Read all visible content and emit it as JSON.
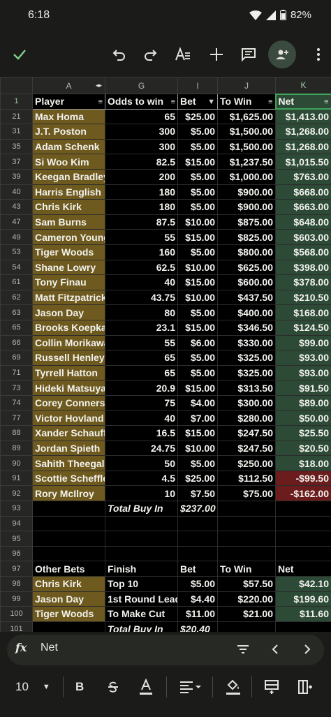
{
  "status": {
    "time": "6:18",
    "battery": "82%"
  },
  "toolbar": {
    "icons": [
      "check-icon",
      "undo-icon",
      "redo-icon",
      "text-format-icon",
      "add-icon",
      "comment-icon",
      "share-icon",
      "more-vert-icon"
    ]
  },
  "columns": [
    "A",
    "G",
    "I",
    "J",
    "K"
  ],
  "header": {
    "row": "1",
    "player": "Player",
    "odds": "Odds to win",
    "bet": "Bet",
    "towin": "To Win",
    "net": "Net"
  },
  "rows": [
    {
      "r": "21",
      "player": "Max Homa",
      "odds": "65",
      "bet": "$25.00",
      "towin": "$1,625.00",
      "net": "$1,413.00"
    },
    {
      "r": "31",
      "player": "J.T. Poston",
      "odds": "300",
      "bet": "$5.00",
      "towin": "$1,500.00",
      "net": "$1,268.00"
    },
    {
      "r": "35",
      "player": "Adam Schenk",
      "odds": "300",
      "bet": "$5.00",
      "towin": "$1,500.00",
      "net": "$1,268.00"
    },
    {
      "r": "37",
      "player": "Si Woo Kim",
      "odds": "82.5",
      "bet": "$15.00",
      "towin": "$1,237.50",
      "net": "$1,015.50"
    },
    {
      "r": "39",
      "player": "Keegan Bradley",
      "odds": "200",
      "bet": "$5.00",
      "towin": "$1,000.00",
      "net": "$763.00"
    },
    {
      "r": "40",
      "player": "Harris English",
      "odds": "180",
      "bet": "$5.00",
      "towin": "$900.00",
      "net": "$668.00"
    },
    {
      "r": "43",
      "player": "Chris Kirk",
      "odds": "180",
      "bet": "$5.00",
      "towin": "$900.00",
      "net": "$663.00"
    },
    {
      "r": "47",
      "player": "Sam Burns",
      "odds": "87.5",
      "bet": "$10.00",
      "towin": "$875.00",
      "net": "$648.00"
    },
    {
      "r": "49",
      "player": "Cameron Young",
      "odds": "55",
      "bet": "$15.00",
      "towin": "$825.00",
      "net": "$603.00"
    },
    {
      "r": "53",
      "player": "Tiger Woods",
      "odds": "160",
      "bet": "$5.00",
      "towin": "$800.00",
      "net": "$568.00"
    },
    {
      "r": "54",
      "player": "Shane Lowry",
      "odds": "62.5",
      "bet": "$10.00",
      "towin": "$625.00",
      "net": "$398.00"
    },
    {
      "r": "61",
      "player": "Tony Finau",
      "odds": "40",
      "bet": "$15.00",
      "towin": "$600.00",
      "net": "$378.00"
    },
    {
      "r": "62",
      "player": "Matt Fitzpatrick",
      "odds": "43.75",
      "bet": "$10.00",
      "towin": "$437.50",
      "net": "$210.50"
    },
    {
      "r": "63",
      "player": "Jason Day",
      "odds": "80",
      "bet": "$5.00",
      "towin": "$400.00",
      "net": "$168.00"
    },
    {
      "r": "65",
      "player": "Brooks Koepka",
      "odds": "23.1",
      "bet": "$15.00",
      "towin": "$346.50",
      "net": "$124.50"
    },
    {
      "r": "66",
      "player": "Collin Morikawa",
      "odds": "55",
      "bet": "$6.00",
      "towin": "$330.00",
      "net": "$99.00"
    },
    {
      "r": "69",
      "player": "Russell Henley",
      "odds": "65",
      "bet": "$5.00",
      "towin": "$325.00",
      "net": "$93.00"
    },
    {
      "r": "71",
      "player": "Tyrrell Hatton",
      "odds": "65",
      "bet": "$5.00",
      "towin": "$325.00",
      "net": "$93.00"
    },
    {
      "r": "73",
      "player": "Hideki Matsuyama",
      "odds": "20.9",
      "bet": "$15.00",
      "towin": "$313.50",
      "net": "$91.50"
    },
    {
      "r": "74",
      "player": "Corey Conners",
      "odds": "75",
      "bet": "$4.00",
      "towin": "$300.00",
      "net": "$89.00"
    },
    {
      "r": "77",
      "player": "Victor Hovland",
      "odds": "40",
      "bet": "$7.00",
      "towin": "$280.00",
      "net": "$50.00"
    },
    {
      "r": "88",
      "player": "Xander Schauffele",
      "odds": "16.5",
      "bet": "$15.00",
      "towin": "$247.50",
      "net": "$25.50"
    },
    {
      "r": "89",
      "player": "Jordan Spieth",
      "odds": "24.75",
      "bet": "$10.00",
      "towin": "$247.50",
      "net": "$20.50"
    },
    {
      "r": "90",
      "player": "Sahith Theegala",
      "odds": "50",
      "bet": "$5.00",
      "towin": "$250.00",
      "net": "$18.00"
    },
    {
      "r": "91",
      "player": "Scottie Scheffler",
      "odds": "4.5",
      "bet": "$25.00",
      "towin": "$112.50",
      "net": "-$99.50"
    },
    {
      "r": "92",
      "player": "Rory McIlroy",
      "odds": "10",
      "bet": "$7.50",
      "towin": "$75.00",
      "net": "-$162.00"
    }
  ],
  "total1": {
    "r": "93",
    "label": "Total Buy In",
    "value": "$237.00"
  },
  "empty_rows": [
    "94",
    "95",
    "96"
  ],
  "other_header": {
    "r": "97",
    "a": "Other Bets",
    "g": "Finish",
    "i": "Bet",
    "j": "To Win",
    "k": "Net"
  },
  "other_rows": [
    {
      "r": "98",
      "player": "Chris Kirk",
      "finish": "Top 10",
      "bet": "$5.00",
      "towin": "$57.50",
      "net": "$42.10"
    },
    {
      "r": "99",
      "player": "Jason Day",
      "finish": "1st Round Leader",
      "bet": "$4.40",
      "towin": "$220.00",
      "net": "$199.60"
    },
    {
      "r": "100",
      "player": "Tiger Woods",
      "finish": "To Make Cut",
      "bet": "$11.00",
      "towin": "$21.00",
      "net": "$11.60"
    }
  ],
  "total2": {
    "r": "101",
    "label": "Total Buy In",
    "value": "$20.40"
  },
  "formula": {
    "fx": "fx",
    "value": "Net"
  },
  "format_bar": {
    "font_size": "10"
  },
  "colors": {
    "player_fill": "#6e5a1e",
    "net_fill": "#2d4a36",
    "negative_fill": "#6b1c1d",
    "selection": "#3ea559"
  }
}
